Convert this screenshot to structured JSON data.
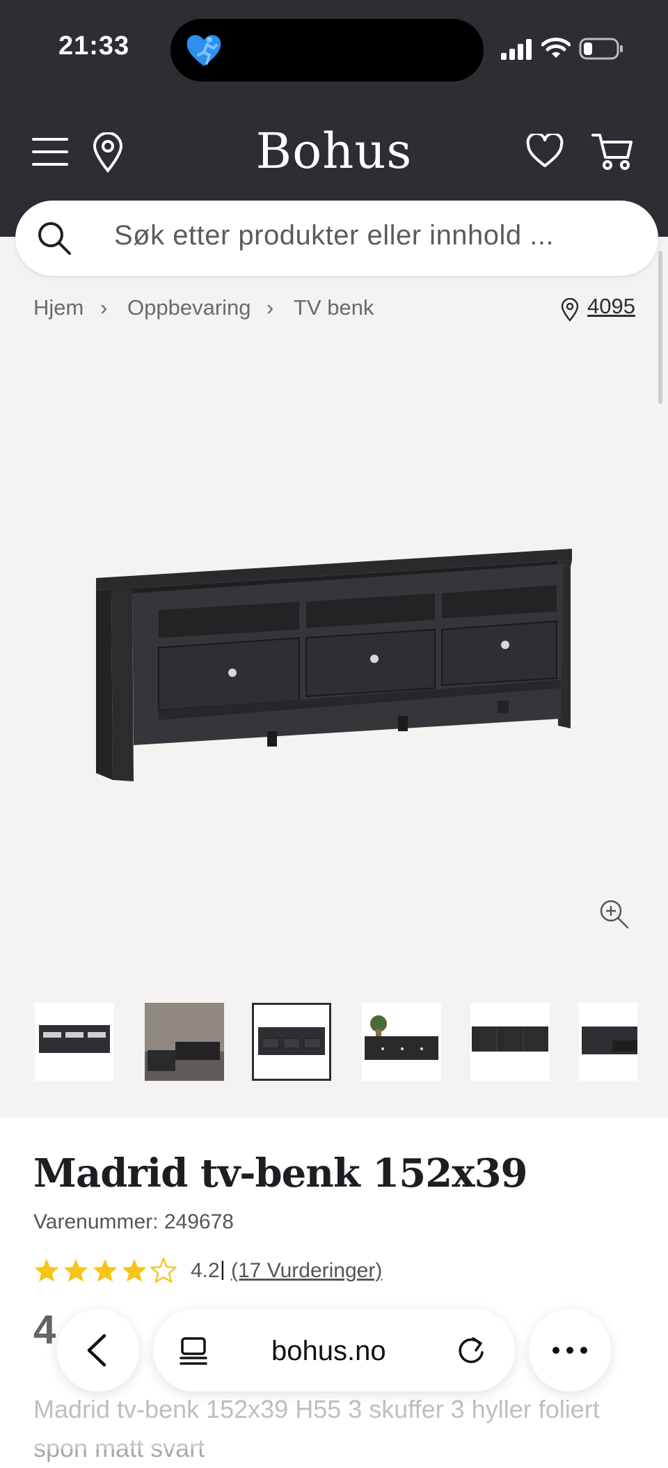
{
  "status_bar": {
    "time": "21:33"
  },
  "header": {
    "logo": "Bohus"
  },
  "search": {
    "placeholder": "Søk etter produkter eller innhold ..."
  },
  "breadcrumb": {
    "items": [
      "Hjem",
      "Oppbevaring",
      "TV benk"
    ],
    "store_number": "4095"
  },
  "gallery": {
    "thumbnail_count": 6,
    "active_index": 2
  },
  "product": {
    "title": "Madrid tv-benk 152x39",
    "sku": "Varenummer: 249678",
    "rating": 4.2,
    "rating_text": "4.2",
    "rating_separator": "|",
    "rating_count": "(17 Vurderinger)",
    "price_partial": "4",
    "description": "Madrid tv-benk 152x39 H55 3 skuffer 3 hyller foliert spon matt svart"
  },
  "browser": {
    "url": "bohus.no"
  },
  "colors": {
    "header_bg": "#2e2d33",
    "page_bg": "#f4f3f1",
    "star": "#f5c518",
    "island": "#000000",
    "fitness_icon": "#2f8ff0"
  },
  "icons": [
    "menu-icon",
    "location-pin-icon",
    "heart-icon",
    "cart-icon",
    "search-icon",
    "zoom-in-icon",
    "back-icon",
    "tabs-icon",
    "reload-icon",
    "more-icon",
    "signal-icon",
    "wifi-icon",
    "battery-icon",
    "fitness-icon"
  ]
}
